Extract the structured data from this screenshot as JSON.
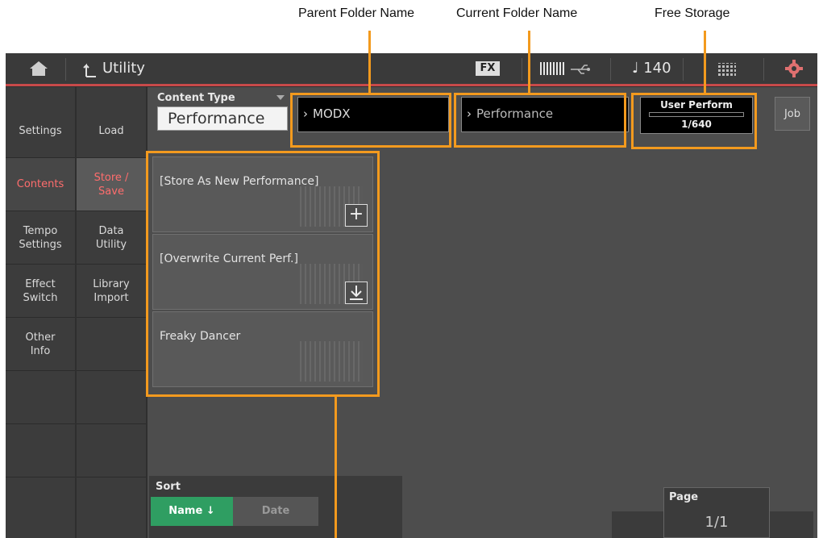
{
  "callouts": {
    "parent_folder": "Parent Folder Name",
    "current_folder": "Current Folder Name",
    "free_storage": "Free Storage"
  },
  "topbar": {
    "title": "Utility",
    "fx": "FX",
    "tempo": "♩ 140",
    "icons": [
      "home-icon",
      "back-icon",
      "keyboard-icon",
      "usb-icon",
      "grid-icon",
      "gear-icon"
    ]
  },
  "left_col1": [
    {
      "label": "Settings"
    },
    {
      "label": "Contents"
    },
    {
      "label": "Tempo Settings"
    },
    {
      "label": "Effect Switch"
    },
    {
      "label": "Other Info"
    }
  ],
  "left_col2": [
    {
      "label": "Load"
    },
    {
      "label": "Store / Save"
    },
    {
      "label": "Data Utility"
    },
    {
      "label": "Library Import"
    }
  ],
  "content_type": {
    "header": "Content Type",
    "value": "Performance"
  },
  "path": {
    "parent": "MODX",
    "current": "Performance"
  },
  "storage": {
    "header": "User Perform",
    "value": "1/640"
  },
  "job_label": "Job",
  "tiles": [
    {
      "label": "[Store As New Performance]",
      "icon": "plus-icon"
    },
    {
      "label": "[Overwrite Current Perf.]",
      "icon": "download-icon"
    },
    {
      "label": "Freaky Dancer",
      "icon": ""
    }
  ],
  "sort": {
    "header": "Sort",
    "name_label": "Name ↓",
    "date_label": "Date"
  },
  "page": {
    "header": "Page",
    "value": "1/1"
  },
  "colors": {
    "accent": "#f39a1e",
    "active_tab": "#ff6d6d",
    "sort_active": "#2f9e62"
  }
}
